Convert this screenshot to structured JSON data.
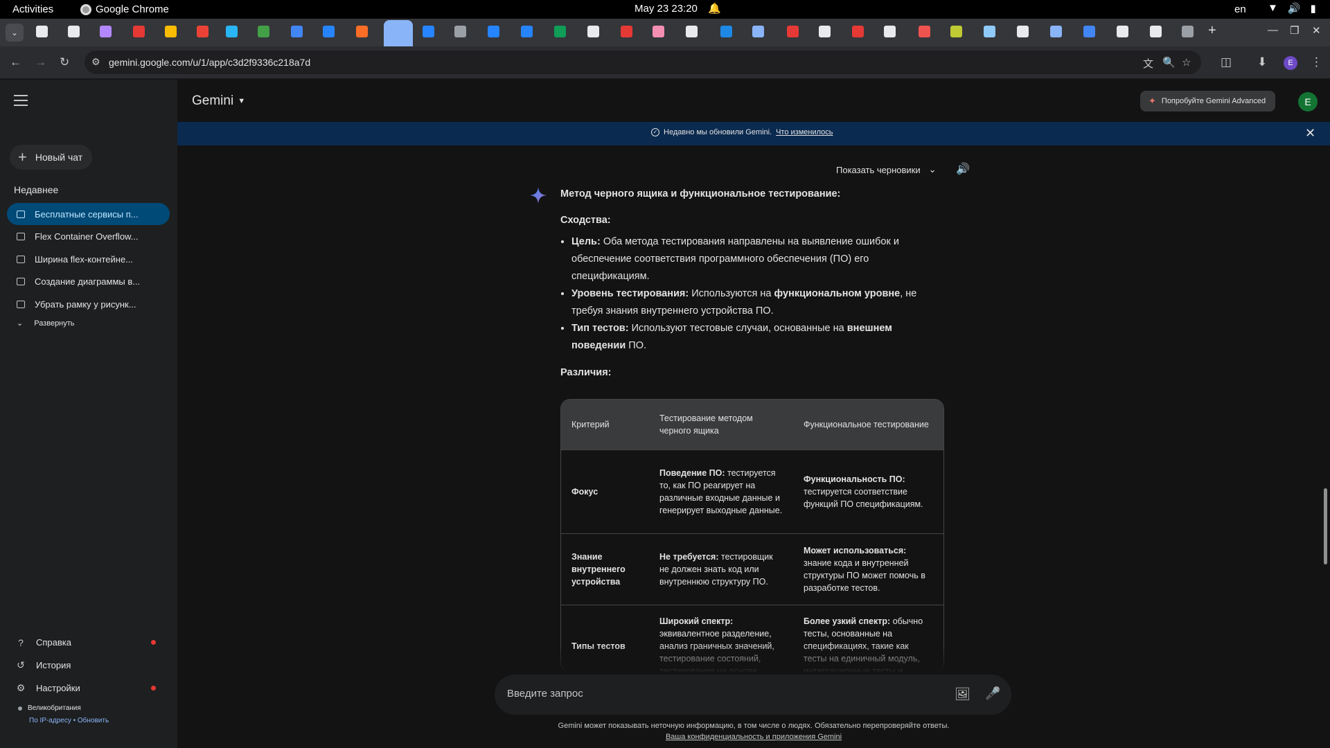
{
  "os": {
    "activities": "Activities",
    "app_name": "Google Chrome",
    "datetime": "May 23  23:20",
    "lang": "en"
  },
  "browser": {
    "url": "gemini.google.com/u/1/app/c3d2f9336c218a7d",
    "profile_initial": "E",
    "tab_favicons": [
      "trello",
      "notion",
      "proton",
      "adobe",
      "slides",
      "gmail",
      "telegram",
      "chat",
      "calendar",
      "jira",
      "gitlab",
      "gemini",
      "jira",
      "web",
      "jira",
      "jira",
      "sheets",
      "docs",
      "close-x",
      "figma",
      "medium",
      "bird",
      "email",
      "adobe",
      "github",
      "adobe",
      "medium",
      "calc",
      "globe",
      "translate",
      "google",
      "email",
      "outlook",
      "google",
      "star",
      "extension"
    ]
  },
  "sidebar": {
    "new_chat": "Новый чат",
    "recent_heading": "Недавнее",
    "chats": [
      {
        "label": "Бесплатные сервисы п...",
        "active": true
      },
      {
        "label": "Flex Container Overflow...",
        "active": false
      },
      {
        "label": "Ширина flex-контейне...",
        "active": false
      },
      {
        "label": "Создание диаграммы в...",
        "active": false
      },
      {
        "label": "Убрать рамку у рисунк...",
        "active": false
      }
    ],
    "expand": "Развернуть",
    "footer": {
      "help": "Справка",
      "history": "История",
      "settings": "Настройки"
    },
    "location": {
      "country": "Великобритания",
      "by_ip": "По IP-адресу",
      "separator": "•",
      "refresh": "Обновить"
    }
  },
  "header": {
    "title": "Gemini",
    "advanced_button": "Попробуйте Gemini Advanced",
    "avatar": "E"
  },
  "banner": {
    "text": "Недавно мы обновили Gemini.",
    "link": "Что изменилось"
  },
  "response": {
    "show_drafts": "Показать черновики",
    "title": "Метод черного ящика и функциональное тестирование:",
    "similarities_heading": "Сходства:",
    "similarities": [
      {
        "label": "Цель:",
        "text": "Оба метода тестирования направлены на выявление ошибок и обеспечение соответствия программного обеспечения (ПО) его спецификациям."
      },
      {
        "label": "Уровень тестирования:",
        "pre": "Используются на",
        "bold": "функциональном уровне",
        "post": ", не требуя знания внутреннего устройства ПО."
      },
      {
        "label": "Тип тестов:",
        "pre": "Используют тестовые случаи, основанные на",
        "bold": "внешнем поведении",
        "post": "ПО."
      }
    ],
    "differences_heading": "Различия:",
    "table": {
      "headers": [
        "Критерий",
        "Тестирование методом черного ящика",
        "Функциональное тестирование"
      ],
      "rows": [
        {
          "criterion": "Фокус",
          "bb_label": "Поведение ПО:",
          "bb_text": "тестируется то, как ПО реагирует на различные входные данные и генерирует выходные данные.",
          "ft_label": "Функциональность ПО:",
          "ft_text": "тестируется соответствие функций ПО спецификациям."
        },
        {
          "criterion": "Знание внутреннего устройства",
          "bb_label": "Не требуется:",
          "bb_text": "тестировщик не должен знать код или внутреннюю структуру ПО.",
          "ft_label": "Может использоваться:",
          "ft_text": "знание кода и внутренней структуры ПО может помочь в разработке тестов."
        },
        {
          "criterion": "Типы тестов",
          "bb_label": "Широкий спектр:",
          "bb_text": "эквивалентное разделение, анализ граничных значений, тестирование состояний, тестирование на основе",
          "ft_label": "Более узкий спектр:",
          "ft_text": "обычно тесты, основанные на спецификациях, такие как тесты на единичный модуль, интеграционные тесты и"
        }
      ]
    }
  },
  "input": {
    "placeholder": "Введите запрос"
  },
  "disclaimer": {
    "text": "Gemini может показывать неточную информацию, в том числе о людях. Обязательно перепроверяйте ответы.",
    "link": "Ваша конфиденциальность и приложения Gemini"
  },
  "colors": {
    "page_bg": "#131314",
    "sidebar_bg": "#1e1f20",
    "active_chat_bg": "#004a77",
    "banner_bg": "#0b2a4f",
    "avatar_bg": "#137333"
  }
}
